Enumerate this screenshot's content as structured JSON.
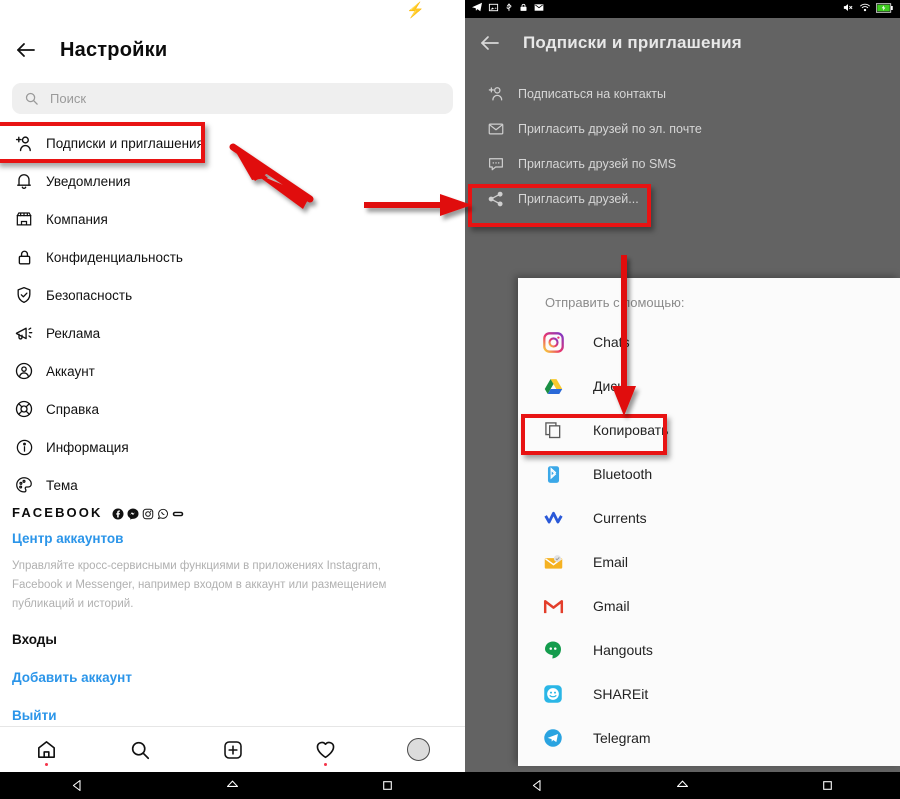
{
  "colors": {
    "accent_red": "#e81313",
    "link_blue": "#2b95e9",
    "battery_green": "#36c516",
    "dark_bg": "#636363",
    "sheet_bg": "#fbfbfb"
  },
  "left_phone": {
    "statusbar": {
      "battery_icon": "battery-charging-icon"
    },
    "header": {
      "back_icon": "arrow-left-icon",
      "title": "Настройки"
    },
    "search": {
      "icon": "search-icon",
      "placeholder": "Поиск",
      "value": ""
    },
    "menu_items": [
      {
        "icon": "person-add-icon",
        "label": "Подписки и приглашения",
        "highlighted": true
      },
      {
        "icon": "bell-icon",
        "label": "Уведомления"
      },
      {
        "icon": "store-icon",
        "label": "Компания"
      },
      {
        "icon": "lock-icon",
        "label": "Конфиденциальность"
      },
      {
        "icon": "shield-check-icon",
        "label": "Безопасность"
      },
      {
        "icon": "megaphone-icon",
        "label": "Реклама"
      },
      {
        "icon": "account-circle-icon",
        "label": "Аккаунт"
      },
      {
        "icon": "lifebuoy-icon",
        "label": "Справка"
      },
      {
        "icon": "info-circle-icon",
        "label": "Информация"
      },
      {
        "icon": "palette-icon",
        "label": "Тема"
      }
    ],
    "facebook_section": {
      "wordmark": "FACEBOOK",
      "brand_icons": [
        "facebook-icon",
        "messenger-icon",
        "instagram-icon",
        "whatsapp-icon",
        "oculus-icon"
      ],
      "accounts_center_link": "Центр аккаунтов",
      "description": "Управляйте кросс-сервисными функциями в приложениях Instagram, Facebook и Messenger, например входом в аккаунт или размещением публикаций и историй."
    },
    "logins_section": {
      "heading": "Входы",
      "add_account_link": "Добавить аккаунт",
      "logout_link": "Выйти"
    },
    "tabbar": [
      {
        "icon": "home-icon",
        "badge_dot": true
      },
      {
        "icon": "search-icon",
        "badge_dot": false
      },
      {
        "icon": "add-box-icon",
        "badge_dot": false
      },
      {
        "icon": "heart-icon",
        "badge_dot": true
      },
      {
        "icon": "profile-avatar-icon",
        "badge_dot": false
      }
    ],
    "navbar": [
      {
        "icon": "android-back-icon"
      },
      {
        "icon": "android-home-icon"
      },
      {
        "icon": "android-recents-icon"
      }
    ]
  },
  "right_phone": {
    "statusbar": {
      "left_icons": [
        "telegram-icon",
        "screenshot-icon",
        "usb-icon",
        "lock-icon",
        "mail-icon"
      ],
      "right_icons": [
        "volume-mute-icon",
        "wifi-icon",
        "battery-charging-icon"
      ]
    },
    "header": {
      "back_icon": "arrow-left-icon",
      "title": "Подписки и приглашения"
    },
    "menu_items": [
      {
        "icon": "person-add-icon",
        "label": "Подписаться на контакты"
      },
      {
        "icon": "mail-icon",
        "label": "Пригласить друзей по эл. почте"
      },
      {
        "icon": "sms-icon",
        "label": "Пригласить друзей по SMS"
      },
      {
        "icon": "share-icon",
        "label": "Пригласить друзей...",
        "highlighted": true
      }
    ],
    "share_sheet": {
      "title": "Отправить с помощью:",
      "items": [
        {
          "icon": "instagram-icon",
          "label": "Chats"
        },
        {
          "icon": "google-drive-icon",
          "label": "Диск"
        },
        {
          "icon": "copy-icon",
          "label": "Копировать",
          "highlighted": true
        },
        {
          "icon": "bluetooth-icon",
          "label": "Bluetooth"
        },
        {
          "icon": "currents-icon",
          "label": "Currents"
        },
        {
          "icon": "email-icon",
          "label": "Email"
        },
        {
          "icon": "gmail-icon",
          "label": "Gmail"
        },
        {
          "icon": "hangouts-icon",
          "label": "Hangouts"
        },
        {
          "icon": "shareit-icon",
          "label": "SHAREit"
        },
        {
          "icon": "telegram-icon",
          "label": "Telegram"
        }
      ]
    },
    "navbar": [
      {
        "icon": "android-back-icon"
      },
      {
        "icon": "android-home-icon"
      },
      {
        "icon": "android-recents-icon"
      }
    ]
  },
  "annotations": {
    "arrows": [
      {
        "name": "arrow-to-subscriptions",
        "direction": "up-left"
      },
      {
        "name": "arrow-to-invite-friends",
        "direction": "right"
      },
      {
        "name": "arrow-to-copy",
        "direction": "down"
      }
    ],
    "highlight_boxes": [
      "subscriptions-row-highlight",
      "invite-friends-row-highlight",
      "copy-row-highlight"
    ]
  }
}
